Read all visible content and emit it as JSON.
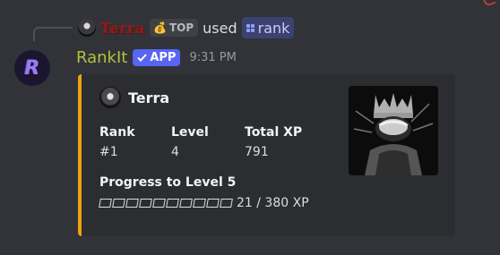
{
  "reply": {
    "username": "Terra",
    "badge_label": "TOP",
    "used_label": "used",
    "command": "rank"
  },
  "message": {
    "username": "RankIt",
    "app_badge": "APP",
    "timestamp": "9:31 PM"
  },
  "embed": {
    "accent_color": "#f1a20a",
    "author": "Terra",
    "fields": {
      "rank": {
        "name": "Rank",
        "value": "#1"
      },
      "level": {
        "name": "Level",
        "value": "4"
      },
      "total_xp": {
        "name": "Total XP",
        "value": "791"
      }
    },
    "progress": {
      "label": "Progress to Level 5",
      "text": "21 / 380 XP",
      "fraction": 0.055,
      "segments_total": 10,
      "segments_filled": 0
    }
  },
  "colors": {
    "background": "#313338",
    "username": "#b4c13a",
    "app_badge": "#5865f2",
    "command_pill": "#3c4270"
  }
}
